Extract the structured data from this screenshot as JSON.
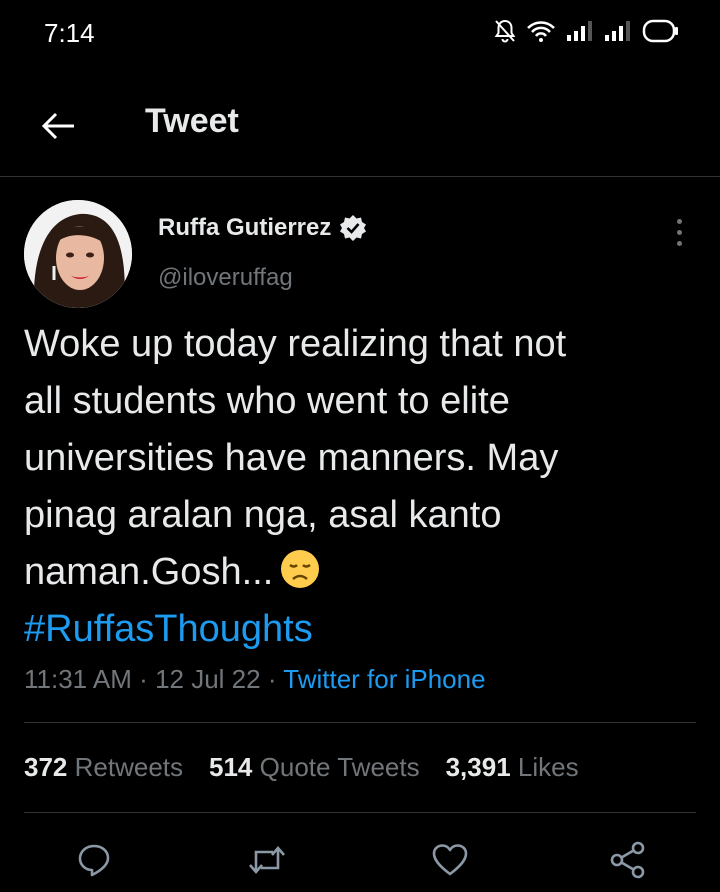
{
  "status_bar": {
    "time": "7:14"
  },
  "header": {
    "title": "Tweet"
  },
  "tweet": {
    "author_name": "Ruffa Gutierrez",
    "author_handle": "@iloveruffag",
    "text_lines": [
      "Woke up today realizing that not",
      "all students who went to elite",
      "universities have manners. May",
      "pinag aralan nga, asal kanto",
      "naman.Gosh..."
    ],
    "hashtag": "#RuffasThoughts",
    "time": "11:31 AM",
    "date": "12 Jul 22",
    "source": "Twitter for iPhone"
  },
  "stats": {
    "retweets_count": "372",
    "retweets_label": "Retweets",
    "quotes_count": "514",
    "quotes_label": "Quote Tweets",
    "likes_count": "3,391",
    "likes_label": "Likes"
  },
  "colors": {
    "accent": "#1d9bf0",
    "text": "#e7e9ea",
    "muted": "#71767b",
    "background": "#000000",
    "divider": "#2f3336"
  },
  "icons": [
    "bell-off-icon",
    "wifi-icon",
    "signal-icon",
    "battery-icon",
    "back-arrow-icon",
    "verified-icon",
    "more-icon",
    "disappointed-emoji-icon",
    "reply-icon",
    "retweet-icon",
    "like-icon",
    "share-icon"
  ]
}
